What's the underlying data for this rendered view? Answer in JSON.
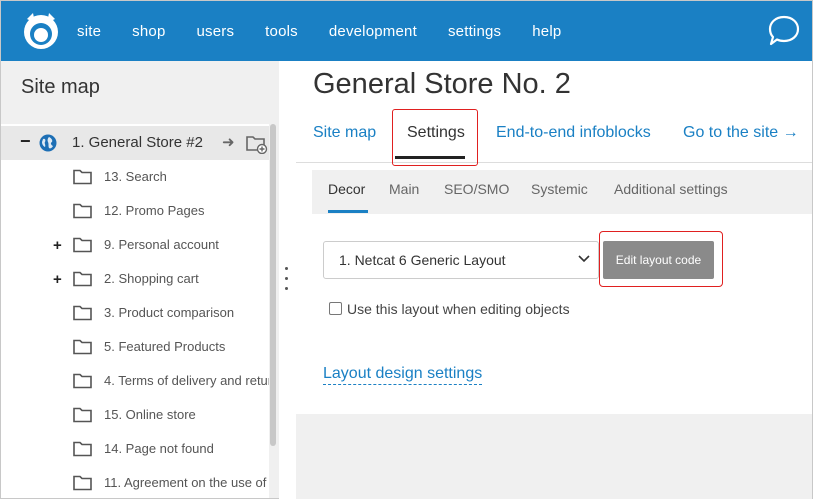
{
  "topbar": {
    "nav": [
      "site",
      "shop",
      "users",
      "tools",
      "development",
      "settings",
      "help"
    ],
    "brand_color": "#1a80c4"
  },
  "sidebar": {
    "title": "Site map",
    "root": {
      "label": "1. General Store #2",
      "icon": "globe-icon"
    },
    "items": [
      {
        "label": "13. Search",
        "expandable": false
      },
      {
        "label": "12. Promo Pages",
        "expandable": false
      },
      {
        "label": "9. Personal account",
        "expandable": true
      },
      {
        "label": "2. Shopping cart",
        "expandable": true
      },
      {
        "label": "3. Product comparison",
        "expandable": false
      },
      {
        "label": "5. Featured Products",
        "expandable": false
      },
      {
        "label": "4. Terms of delivery and retur",
        "expandable": false
      },
      {
        "label": "15. Online store",
        "expandable": false
      },
      {
        "label": "14. Page not found",
        "expandable": false
      },
      {
        "label": "11. Agreement on the use of",
        "expandable": false
      }
    ],
    "expand_symbol": "+",
    "collapse_symbol": "−",
    "go_arrow": "➜"
  },
  "main": {
    "title": "General Store No. 2",
    "tabs": [
      "Site map",
      "Settings",
      "End-to-end infoblocks",
      "Go to the site →"
    ],
    "active_tab": "Settings",
    "subtabs": [
      "Decor",
      "Main",
      "SEO/SMO",
      "Systemic",
      "Additional settings"
    ],
    "active_subtab": "Decor",
    "layout_select": {
      "value": "1. Netcat 6 Generic Layout"
    },
    "edit_button": "Edit layout code",
    "checkbox": {
      "label": "Use this layout when editing objects",
      "checked": false
    },
    "design_link": "Layout design settings"
  },
  "colors": {
    "highlight": "#e02020",
    "link": "#1a80c4",
    "button": "#8a8a8a"
  }
}
